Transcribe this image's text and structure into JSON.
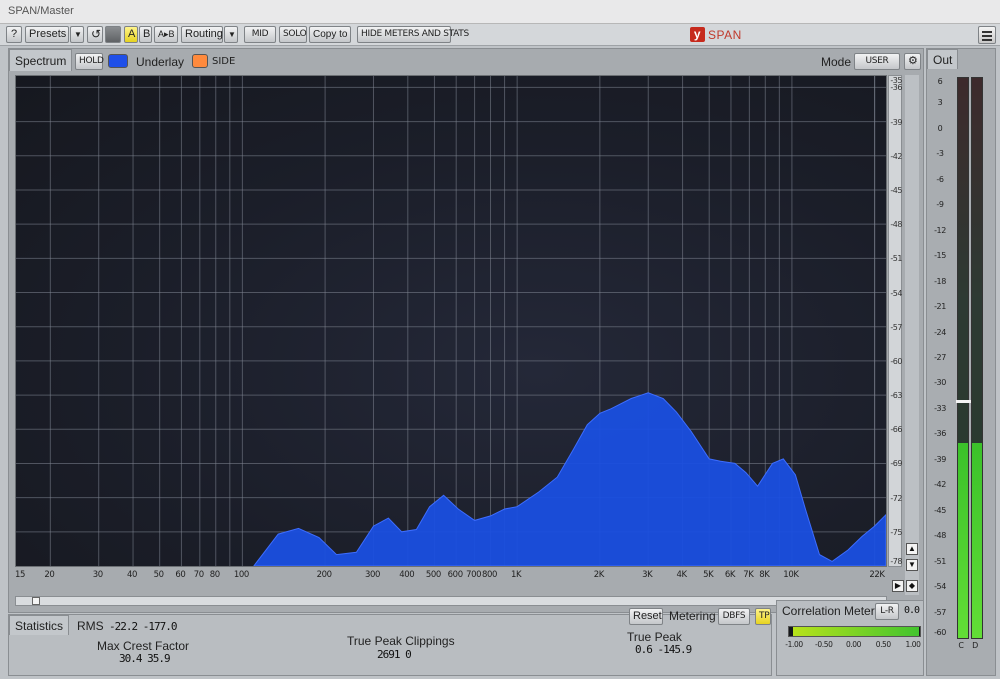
{
  "window": {
    "title": "SPAN/Master"
  },
  "toolbar": {
    "help": "?",
    "presets": "Presets",
    "dropdown_glyph": "▼",
    "undo_glyph": "↺",
    "slot_a": "A",
    "slot_b": "B",
    "a_to_b": "A▸B",
    "routing": "Routing",
    "mid": "MID",
    "solo": "SOLO",
    "copy_to": "Copy to",
    "hide_meters": "HIDE METERS AND STATS",
    "logo_mark": "y",
    "logo_text": "SPAN"
  },
  "spectrum": {
    "tab": "Spectrum",
    "hold": "HOLD",
    "underlay": "Underlay",
    "side": "SIDE",
    "mode_label": "Mode",
    "mode_value": "USER"
  },
  "colors": {
    "fill": "#1a4fe0",
    "side": "#ff8a3d",
    "grid": "#7e8490",
    "hold_swatch": "#1f4fe8"
  },
  "chart_data": {
    "type": "area",
    "title": "",
    "xlabel": "",
    "ylabel": "",
    "x_scale": "log",
    "xlim": [
      15,
      22000
    ],
    "ylim": [
      -78,
      -35
    ],
    "x_ticks": [
      15,
      20,
      30,
      40,
      50,
      60,
      70,
      80,
      100,
      200,
      300,
      400,
      500,
      600,
      700,
      800,
      1000,
      2000,
      3000,
      4000,
      5000,
      6000,
      7000,
      8000,
      10000,
      22000
    ],
    "x_tick_labels": [
      "15",
      "20",
      "30",
      "40",
      "50",
      "60",
      "70",
      "80",
      "100",
      "200",
      "300",
      "400",
      "500",
      "600",
      "700",
      "800",
      "1K",
      "2K",
      "3K",
      "4K",
      "5K",
      "6K",
      "7K",
      "8K",
      "10K",
      "22K"
    ],
    "y_ticks": [
      -35,
      -36,
      -39,
      -42,
      -45,
      -48,
      -51,
      -54,
      -57,
      -60,
      -63,
      -66,
      -69,
      -72,
      -75,
      -78
    ],
    "y_tick_labels": [
      "-35",
      "-36",
      "-39",
      "-42",
      "-45",
      "-48",
      "-51",
      "-54",
      "-57",
      "-60",
      "-63",
      "-66",
      "-69",
      "-72",
      "-75",
      "-78"
    ],
    "grid": true,
    "series": [
      {
        "x": [
          110,
          135,
          160,
          190,
          220,
          260,
          300,
          340,
          380,
          430,
          480,
          540,
          610,
          700,
          800,
          900,
          1000,
          1200,
          1400,
          1600,
          1800,
          2000,
          2200,
          2600,
          3000,
          3400,
          3800,
          4300,
          5000,
          5500,
          6200,
          6800,
          7500,
          8500,
          9300,
          10300,
          11200,
          12600,
          14000,
          16000,
          18000,
          20000,
          22000
        ],
        "y": [
          -78,
          -75.2,
          -74.7,
          -75.5,
          -77,
          -76.8,
          -74.5,
          -73.8,
          -75,
          -74.8,
          -72.8,
          -71.8,
          -73,
          -74,
          -73.6,
          -73,
          -72.8,
          -71.5,
          -70.2,
          -67.8,
          -65.6,
          -64.6,
          -64.2,
          -63.3,
          -62.8,
          -63.3,
          -64.5,
          -66.2,
          -68.6,
          -68.8,
          -69,
          -69.8,
          -71,
          -69,
          -68.6,
          -70,
          -73,
          -77,
          -77.6,
          -76.6,
          -75.4,
          -74.5,
          -73.5
        ]
      }
    ]
  },
  "statistics": {
    "tab": "Statistics",
    "rms_label": "RMS",
    "rms_values": "-22.2  -177.0",
    "max_crest_label": "Max Crest Factor",
    "max_crest_values": "30.4  35.9",
    "clippings_label": "True Peak Clippings",
    "clippings_values": "2691   0",
    "true_peak_label": "True Peak",
    "true_peak_values": "0.6  -145.9",
    "reset": "Reset",
    "metering_label": "Metering",
    "metering_mode": "DBFS",
    "tp_badge": "TP"
  },
  "correlation": {
    "title": "Correlation Meter",
    "channel": "L-R",
    "value": "0.0",
    "ticks": [
      "-1.00",
      "-0.50",
      "0.00",
      "0.50",
      "1.00"
    ],
    "fill_from": 0.0,
    "fill_to": 1.0
  },
  "out_meter": {
    "title": "Out",
    "scale": [
      "6",
      "3",
      "0",
      "-3",
      "-6",
      "-9",
      "-12",
      "-15",
      "-18",
      "-21",
      "-24",
      "-27",
      "-30",
      "-33",
      "-36",
      "-39",
      "-42",
      "-45",
      "-48",
      "-51",
      "-54",
      "-57",
      "-60"
    ],
    "scale_min": -60,
    "scale_max": 6,
    "level_db": -37,
    "peak_db": -32,
    "left_channel": "C",
    "right_channel": "D"
  }
}
